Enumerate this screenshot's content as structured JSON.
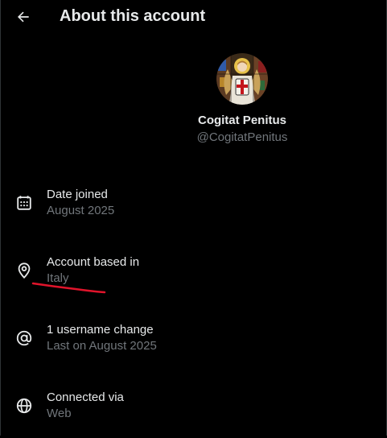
{
  "header": {
    "title": "About this account",
    "back_icon": "arrow-left-icon"
  },
  "profile": {
    "display_name": "Cogitat Penitus",
    "handle": "@CogitatPenitus",
    "avatar_icon": "angel-stained-glass-avatar"
  },
  "details": [
    {
      "icon": "calendar-icon",
      "label": "Date joined",
      "value": "August 2025"
    },
    {
      "icon": "location-pin-icon",
      "label": "Account based in",
      "value": "Italy"
    },
    {
      "icon": "at-sign-icon",
      "label": "1 username change",
      "value": "Last on August 2025"
    },
    {
      "icon": "globe-icon",
      "label": "Connected via",
      "value": "Web"
    }
  ],
  "annotation": {
    "underline_color": "#e0142b"
  },
  "colors": {
    "background": "#000000",
    "primary_text": "#e7e9ea",
    "secondary_text": "#71767b",
    "divider": "#2f3336"
  }
}
